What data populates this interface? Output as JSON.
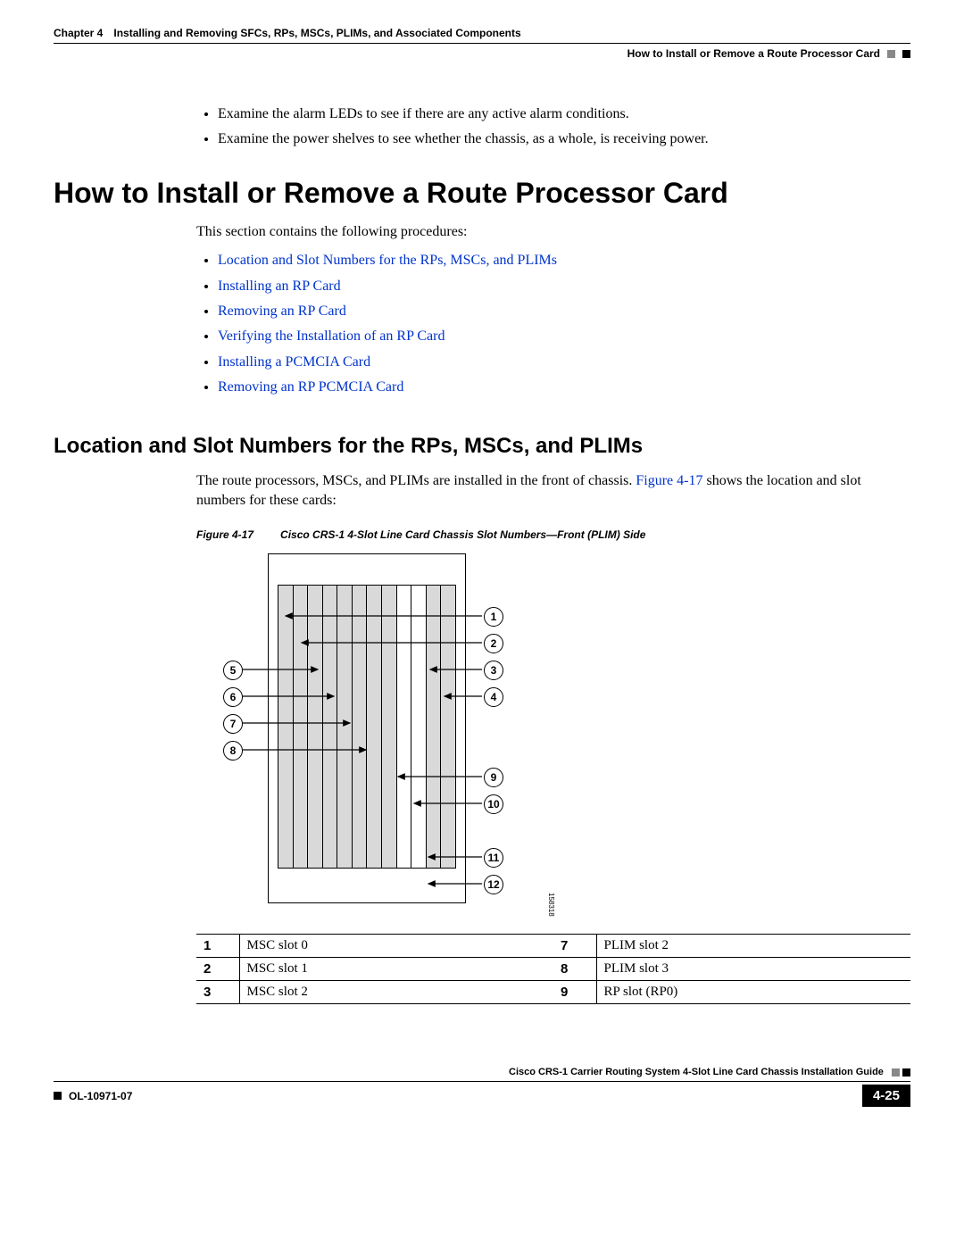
{
  "header": {
    "chapter_label": "Chapter 4",
    "chapter_title": "Installing and Removing SFCs, RPs, MSCs, PLIMs, and Associated Components",
    "section_title": "How to Install or Remove a Route Processor Card"
  },
  "intro_bullets": [
    "Examine the alarm LEDs to see if there are any active alarm conditions.",
    "Examine the power shelves to see whether the chassis, as a whole, is receiving power."
  ],
  "h1": "How to Install or Remove a Route Processor Card",
  "intro_para": "This section contains the following procedures:",
  "proc_links": [
    "Location and Slot Numbers for the RPs, MSCs, and PLIMs",
    "Installing an RP Card",
    "Removing an RP Card",
    "Verifying the Installation of an RP Card",
    "Installing a PCMCIA Card",
    "Removing an RP PCMCIA Card"
  ],
  "h2": "Location and Slot Numbers for the RPs, MSCs, and PLIMs",
  "loc_para_pre": "The route processors, MSCs, and PLIMs are installed in the front of chassis. ",
  "loc_para_figref": "Figure 4-17",
  "loc_para_post": " shows the location and slot numbers for these cards:",
  "figure": {
    "label": "Figure 4-17",
    "title": "Cisco CRS-1 4-Slot Line Card Chassis Slot Numbers—Front (PLIM) Side",
    "image_number": "158318"
  },
  "callouts": {
    "c1": "1",
    "c2": "2",
    "c3": "3",
    "c4": "4",
    "c5": "5",
    "c6": "6",
    "c7": "7",
    "c8": "8",
    "c9": "9",
    "c10": "10",
    "c11": "11",
    "c12": "12"
  },
  "table_rows": [
    {
      "n1": "1",
      "d1": "MSC slot 0",
      "n2": "7",
      "d2": "PLIM slot 2"
    },
    {
      "n1": "2",
      "d1": "MSC slot 1",
      "n2": "8",
      "d2": "PLIM slot 3"
    },
    {
      "n1": "3",
      "d1": "MSC slot 2",
      "n2": "9",
      "d2": "RP slot (RP0)"
    }
  ],
  "footer": {
    "guide": "Cisco CRS-1 Carrier Routing System 4-Slot Line Card Chassis Installation Guide",
    "doc_id": "OL-10971-07",
    "page": "4-25"
  }
}
